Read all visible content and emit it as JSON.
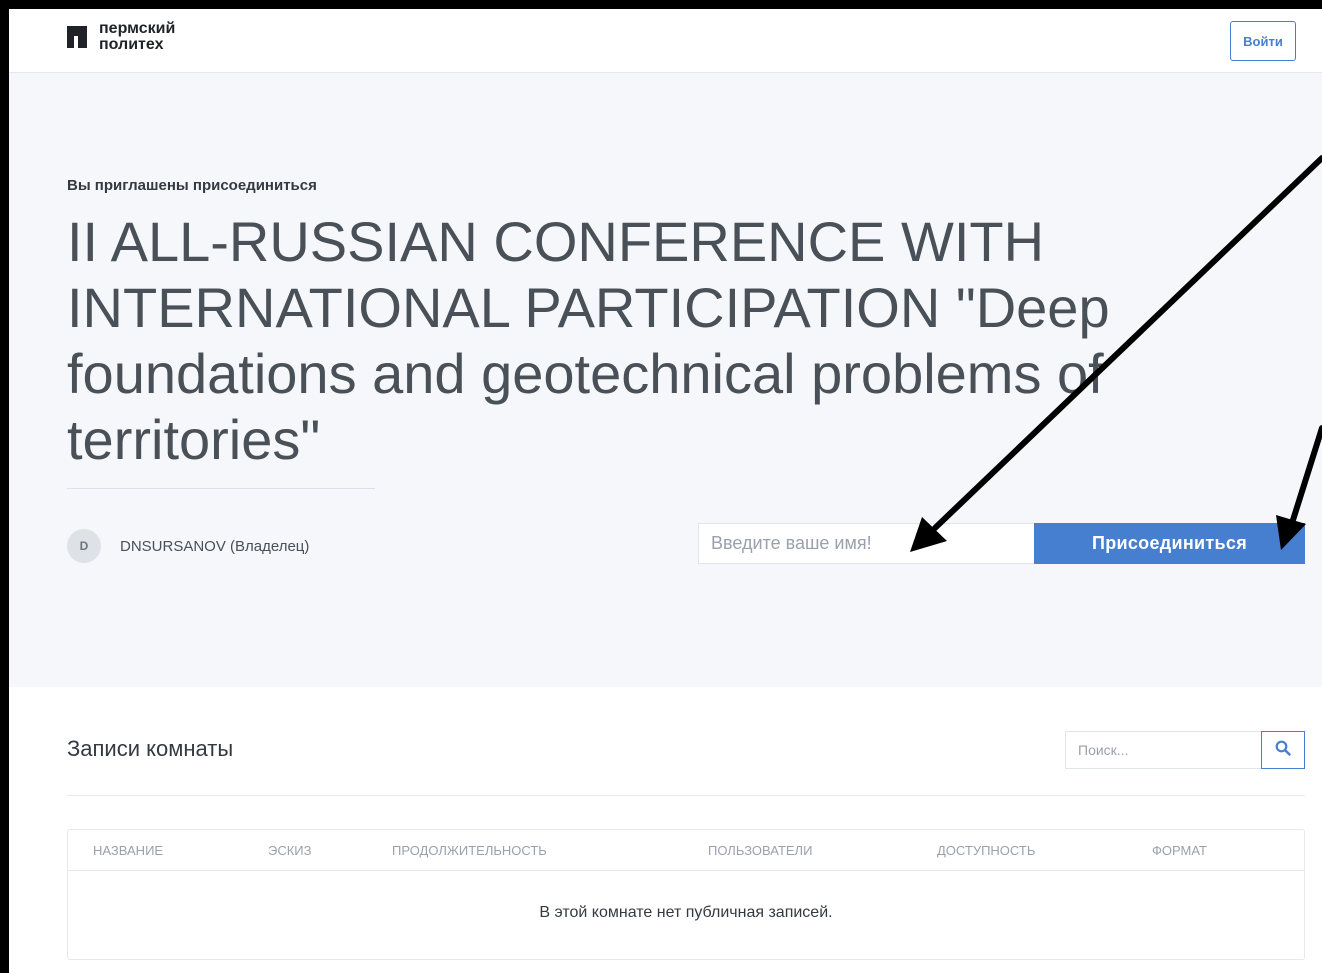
{
  "header": {
    "logo_text": "пермский\nполитех",
    "login_label": "Войти"
  },
  "hero": {
    "invited_text": "Вы приглашены присоединиться",
    "room_title": "II ALL-RUSSIAN CONFERENCE WITH INTERNATIONAL PARTICIPATION \"Deep foundations and geotechnical problems of territories\"",
    "owner": {
      "avatar_initial": "D",
      "name": "DNSURSANOV (Владелец)"
    },
    "join": {
      "name_placeholder": "Введите ваше имя!",
      "join_label": "Присоединиться"
    }
  },
  "recordings": {
    "title": "Записи комнаты",
    "search_placeholder": "Поиск...",
    "columns": [
      "НАЗВАНИЕ",
      "ЭСКИЗ",
      "ПРОДОЛЖИТЕЛЬНОСТЬ",
      "ПОЛЬЗОВАТЕЛИ",
      "ДОСТУПНОСТЬ",
      "ФОРМАТ"
    ],
    "empty_message": "В этой комнате нет публичная записей."
  },
  "colors": {
    "accent": "#467fcf",
    "hero_bg": "#f5f7fb",
    "annotation_arrows": "#000000"
  },
  "icons": {
    "search": "search-icon"
  }
}
